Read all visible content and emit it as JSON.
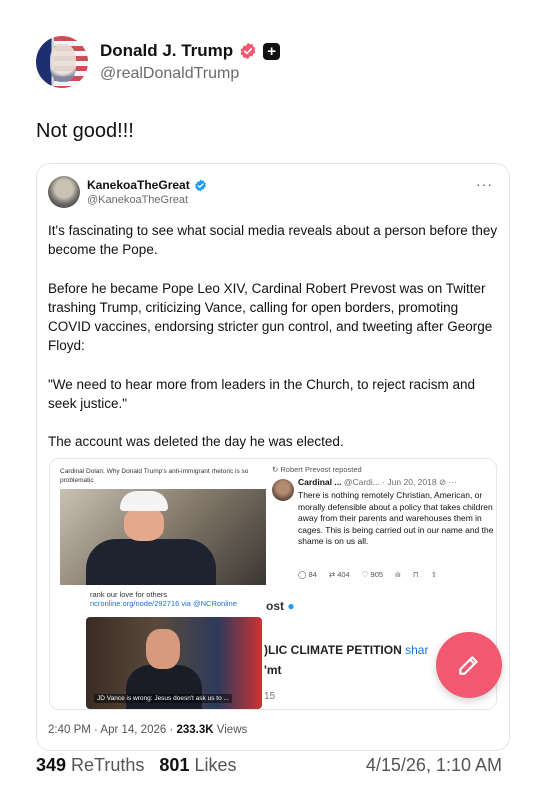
{
  "author": {
    "display_name": "Donald J. Trump",
    "handle": "@realDonaldTrump",
    "icons": [
      "verified-badge-icon",
      "plus-badge-icon"
    ]
  },
  "post": {
    "text": "Not good!!!"
  },
  "embedded": {
    "display_name": "KanekoaTheGreat",
    "handle": "@KanekoaTheGreat",
    "more": "···",
    "body": "It's fascinating to see what social media reveals about a person before they become the Pope.\n\nBefore he became Pope Leo XIV, Cardinal Robert Prevost was on Twitter trashing Trump, criticizing Vance, calling for open borders, promoting COVID vaccines, endorsing stricter gun control, and tweeting after George Floyd:\n\n\"We need to hear more from leaders in the Church, to reject racism and seek justice.\"\n\nThe account was deleted the day he was elected.",
    "media": {
      "left_caption": "Cardinal Dolan: Why Donald Trump's anti-immigrant rhetoric is so problematic",
      "link_text": "rank our love for others",
      "link_url": "ncronline.org/node/292716 via @NCRonline",
      "photo2_caption": "JD Vance is wrong: Jesus doesn't ask us to ...",
      "repost_label": "Robert Prevost reposted",
      "repost_name": "Cardinal ...",
      "repost_handle": "@Cardi... · Jun 20, 2018",
      "repost_body": "There is nothing remotely Christian, American, or morally defensible about a policy that takes children away from their parents and warehouses them in cages. This is being carried out in our name and the shame is on us all.",
      "repost_stats": [
        "84",
        "404",
        "905"
      ],
      "ost_text": "ost",
      "climate_text": ")LIC CLIMATE PETITION",
      "share_text": "shar",
      "mt_text": "'mt",
      "fifteen_text": "15"
    },
    "timestamp": "2:40 PM · Apr 14, 2026 · ",
    "views_count": "233.3K",
    "views_label": " Views"
  },
  "footer": {
    "retruths_count": "349",
    "retruths_label": " ReTruths",
    "likes_count": "801",
    "likes_label": " Likes",
    "date": "4/15/26, 1:10 AM"
  },
  "colors": {
    "verified": "#f2586f",
    "embed_verified": "#1d9bf0",
    "fab": "#f2586f",
    "link": "#1d6fd6"
  },
  "fab_icon": "edit-pencil-icon"
}
